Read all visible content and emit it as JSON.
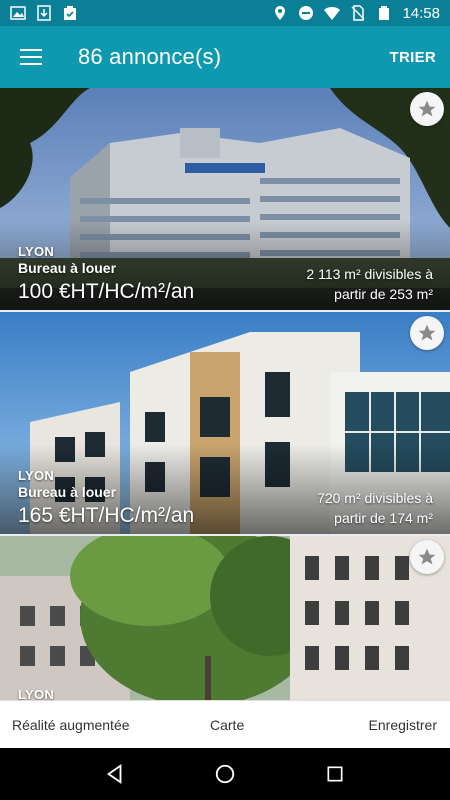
{
  "status_bar": {
    "time": "14:58",
    "left_icons": [
      "image-icon",
      "download-icon",
      "clipboard-check-icon"
    ],
    "right_icons": [
      "location-icon",
      "do-not-disturb-icon",
      "wifi-icon",
      "no-sim-icon",
      "battery-icon"
    ]
  },
  "app_bar": {
    "title": "86 annonce(s)",
    "sort_label": "TRIER"
  },
  "listings": [
    {
      "city": "LYON",
      "type": "Bureau à louer",
      "price": "100 €HT/HC/m²/an",
      "surface": "2 113 m² divisibles à",
      "from": "partir de 253 m²"
    },
    {
      "city": "LYON",
      "type": "Bureau à louer",
      "price": "165 €HT/HC/m²/an",
      "surface": "720 m² divisibles à",
      "from": "partir de 174 m²"
    },
    {
      "city": "LYON",
      "type": "",
      "price": "",
      "surface": "",
      "from": ""
    }
  ],
  "bottom_bar": {
    "ar_label": "Réalité augmentée",
    "map_label": "Carte",
    "save_label": "Enregistrer"
  },
  "colors": {
    "status_bar": "#0a7f95",
    "app_bar": "#0e99b1",
    "nav_bar": "#000000"
  }
}
